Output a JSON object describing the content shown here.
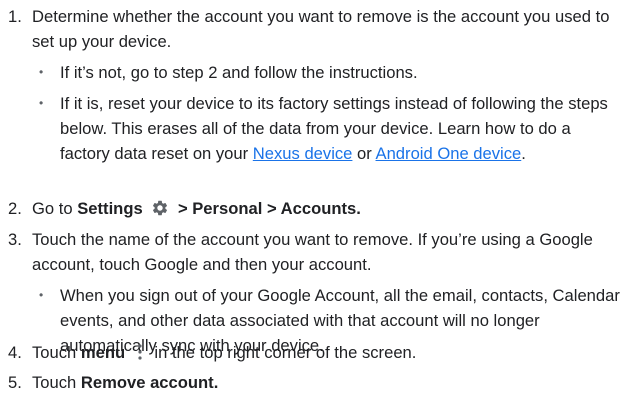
{
  "steps": [
    {
      "num": "1.",
      "text": "Determine whether the account you want to remove is the account you used to set up your device.",
      "bullets": [
        "If it’s not, go to step 2 and follow the instructions.",
        "If it is, reset your device to its factory settings instead of following the steps below. This erases all of the data from your device. Learn how to do a factory data reset on your"
      ],
      "link_nexus": "Nexus device",
      "or_text": "or",
      "link_android": "Android One device",
      "end_period": "."
    },
    {
      "num": "2.",
      "prefix": "Go to",
      "settings_label": "Settings",
      "path": "> Personal > Accounts."
    },
    {
      "num": "3.",
      "text": "Touch the name of the account you want to remove. If you’re using a Google account, touch Google and then your account.",
      "bullet": "When you sign out of your Google Account, all the email, contacts, Calendar events, and other data associated with that account will no longer automatically sync with your device."
    },
    {
      "num": "4.",
      "prefix": "Touch",
      "menu_label": "menu",
      "suffix": "in the top right corner of the screen."
    },
    {
      "num": "5.",
      "prefix": "Touch",
      "action": "Remove account."
    }
  ],
  "icons": {
    "settings": "gear-icon",
    "menu": "more-vert-icon"
  },
  "colors": {
    "text": "#202124",
    "link": "#1a73e8",
    "icon": "#5f6368"
  }
}
